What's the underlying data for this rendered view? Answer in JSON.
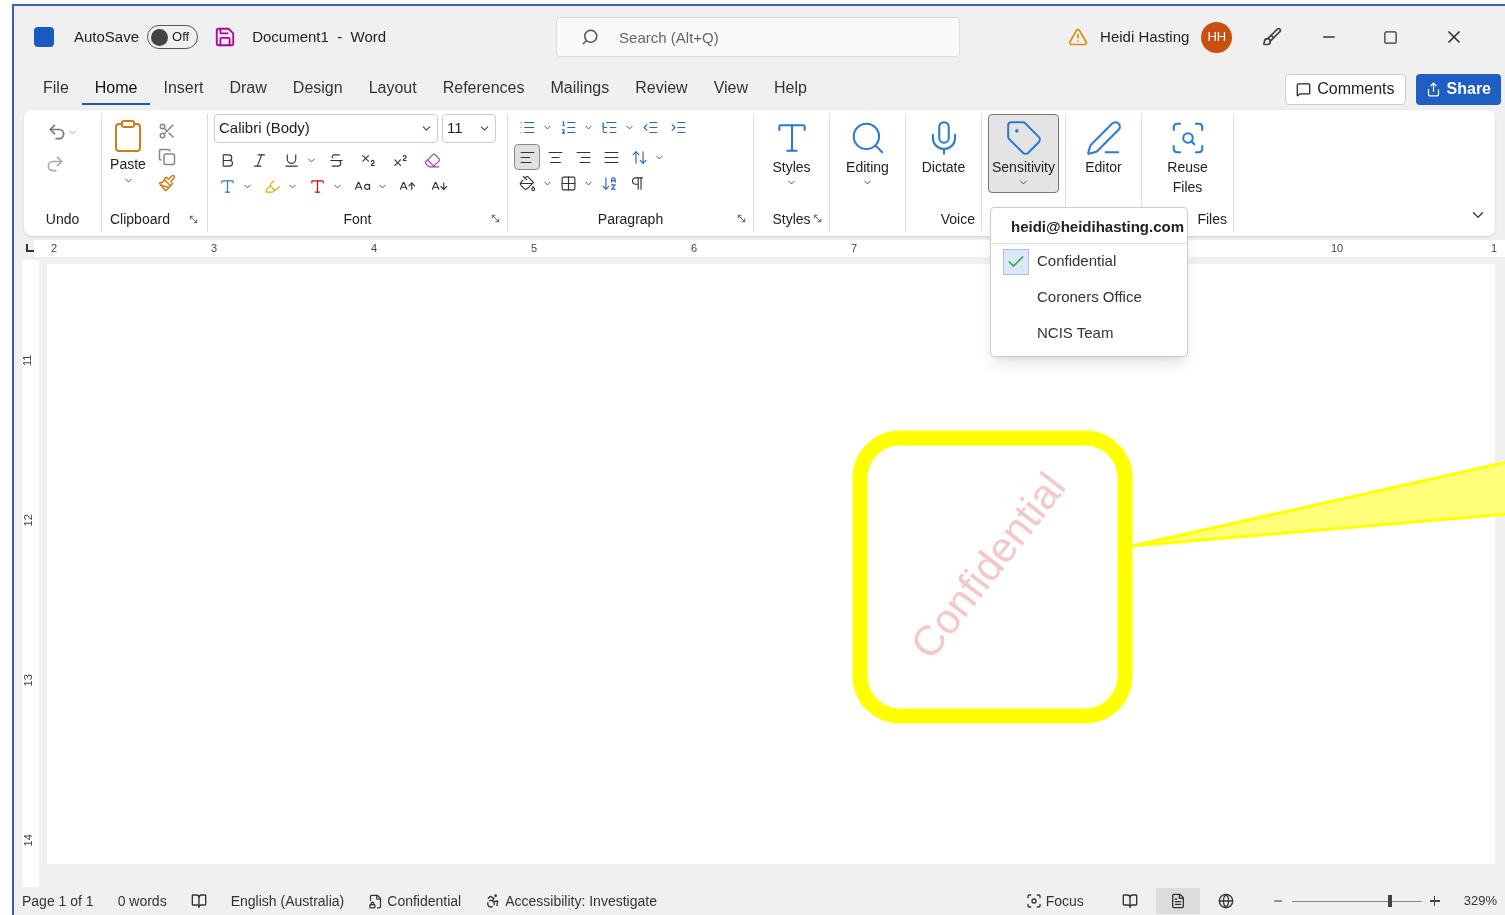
{
  "title_bar": {
    "autosave_label": "AutoSave",
    "autosave": {
      "on": false,
      "label": "Off"
    },
    "document_title": "Document1  -  Word",
    "search": {
      "placeholder": "Search (Alt+Q)"
    },
    "user_name": "Heidi Hasting",
    "avatar_initials": "HH"
  },
  "tabs": [
    {
      "label": "File",
      "selected": false
    },
    {
      "label": "Home",
      "selected": true
    },
    {
      "label": "Insert",
      "selected": false
    },
    {
      "label": "Draw",
      "selected": false
    },
    {
      "label": "Design",
      "selected": false
    },
    {
      "label": "Layout",
      "selected": false
    },
    {
      "label": "References",
      "selected": false
    },
    {
      "label": "Mailings",
      "selected": false
    },
    {
      "label": "Review",
      "selected": false
    },
    {
      "label": "View",
      "selected": false
    },
    {
      "label": "Help",
      "selected": false
    }
  ],
  "comments_button": "Comments",
  "share_button": "Share",
  "ribbon": {
    "undo_label": "Undo",
    "clipboard": {
      "paste": "Paste",
      "label": "Clipboard"
    },
    "font": {
      "font_name": "Calibri (Body)",
      "font_size": "11",
      "label": "Font"
    },
    "paragraph": {
      "label": "Paragraph",
      "alignment": [
        {
          "kind": "left",
          "selected": true
        },
        {
          "kind": "center",
          "selected": false
        },
        {
          "kind": "right",
          "selected": false
        },
        {
          "kind": "justify",
          "selected": false
        }
      ]
    },
    "large_groups": [
      {
        "label": "Styles",
        "launcher": true,
        "button": {
          "kind": "styles",
          "label": "Styles",
          "dropdown": true,
          "selected": false
        }
      },
      {
        "button": {
          "kind": "editing",
          "label": "Editing",
          "dropdown": true,
          "selected": false
        }
      },
      {
        "label": "Voice",
        "launcher": false,
        "button": {
          "kind": "dictate",
          "label": "Dictate",
          "dropdown": false,
          "selected": false
        }
      },
      {
        "button": {
          "kind": "sensitivity",
          "label": "Sensitivity",
          "dropdown": true,
          "selected": true
        }
      },
      {
        "button": {
          "kind": "editor",
          "label": "Editor",
          "dropdown": false,
          "selected": false
        }
      },
      {
        "label": "Files",
        "launcher": false,
        "button": {
          "kind": "reuse",
          "label": "Reuse Files",
          "dropdown": false,
          "selected": false
        }
      }
    ]
  },
  "sensitivity_menu": {
    "account": "heidi@heidihasting.com",
    "labels": [
      {
        "label": "Confidential",
        "checked": true
      },
      {
        "label": "Coroners Office",
        "checked": false
      },
      {
        "label": "NCIS Team",
        "checked": false
      }
    ]
  },
  "ruler": {
    "horizontal_before": [
      "2",
      "3",
      "4",
      "5",
      "6",
      "7"
    ],
    "horizontal_after": [
      "10",
      "1"
    ],
    "vertical": [
      "11",
      "12",
      "13",
      "14"
    ]
  },
  "document": {
    "watermark": "Confidential"
  },
  "status_bar": {
    "page": "Page 1 of 1",
    "words": "0 words",
    "language": "English (Australia)",
    "sensitivity": "Confidential",
    "accessibility": "Accessibility: Investigate",
    "focus": "Focus",
    "views": [
      {
        "kind": "read",
        "selected": false
      },
      {
        "kind": "print",
        "selected": true
      },
      {
        "kind": "web",
        "selected": false
      }
    ],
    "zoom": {
      "level": 0.76,
      "reading": "329%"
    }
  }
}
